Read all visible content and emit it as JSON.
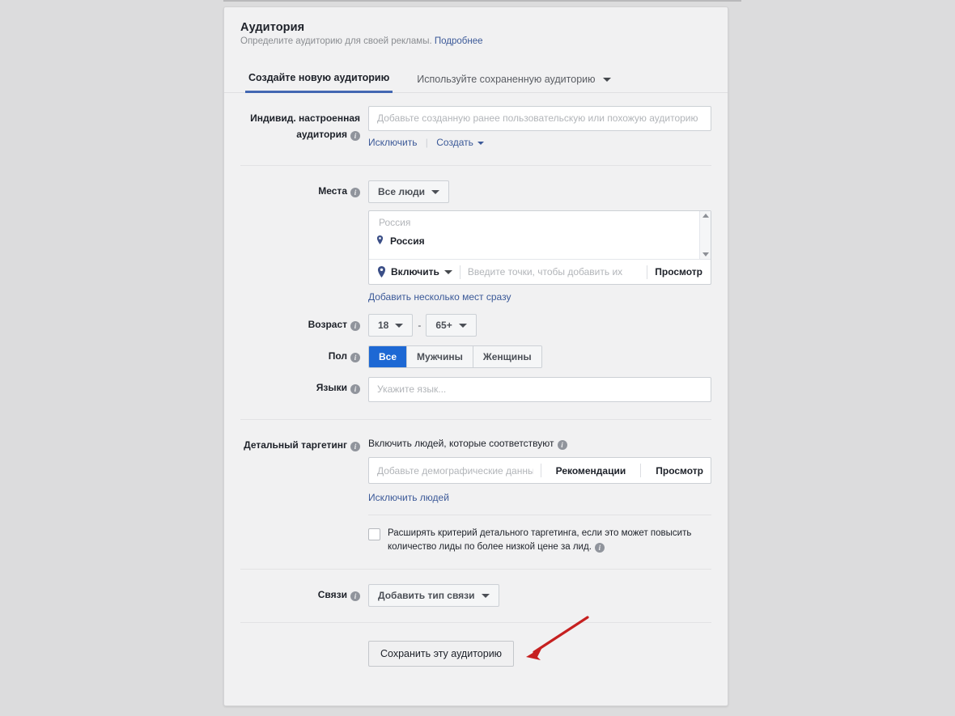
{
  "card": {
    "title": "Аудитория",
    "subtitle": "Определите аудиторию для своей рекламы.",
    "subtitle_link": "Подробнее"
  },
  "tabs": [
    {
      "label": "Создайте новую аудиторию",
      "active": true
    },
    {
      "label": "Используйте сохраненную аудиторию",
      "active": false,
      "caret": "chevron-down-icon"
    }
  ],
  "custom_audience": {
    "label_line1": "Индивид. настроенная",
    "label_line2": "аудитория",
    "placeholder": "Добавьте созданную ранее пользовательскую или похожую аудиторию",
    "value": "",
    "exclude_link": "Исключить",
    "create_link": "Создать"
  },
  "places": {
    "label": "Места",
    "scope_button": "Все люди",
    "list_title": "Россия",
    "list_items": [
      "Россия"
    ],
    "mode_button": "Включить",
    "input_placeholder": "Введите точки, чтобы добавить их",
    "input_value": "",
    "preview_button": "Просмотр",
    "bulk_link": "Добавить несколько мест сразу"
  },
  "age": {
    "label": "Возраст",
    "min": "18",
    "max": "65+",
    "dash": "-"
  },
  "gender": {
    "label": "Пол",
    "options": [
      "Все",
      "Мужчины",
      "Женщины"
    ],
    "selected": "Все"
  },
  "languages": {
    "label": "Языки",
    "placeholder": "Укажите язык...",
    "value": ""
  },
  "detailed_targeting": {
    "label": "Детальный таргетинг",
    "include_heading": "Включить людей, которые соответствуют",
    "placeholder": "Добавьте демографические данные, интересы",
    "value": "",
    "suggestions_button": "Рекомендации",
    "preview_button": "Просмотр",
    "exclude_link": "Исключить людей",
    "expand_checkbox_line1": "Расширять критерий детального таргетинга, если это может повысить",
    "expand_checkbox_line2": "количество лиды по более низкой цене за лид.",
    "expand_checked": false
  },
  "connections": {
    "label": "Связи",
    "button": "Добавить тип связи"
  },
  "save": {
    "button": "Сохранить эту аудиторию"
  },
  "colors": {
    "page_background": "#dcdcdd",
    "card_background": "#f1f1f2",
    "accent_blue": "#1d68d4",
    "tab_underline": "#4267b2",
    "link_blue": "#3b5998",
    "pin_navy": "#3b4f87",
    "annotation_red": "#c62020"
  }
}
